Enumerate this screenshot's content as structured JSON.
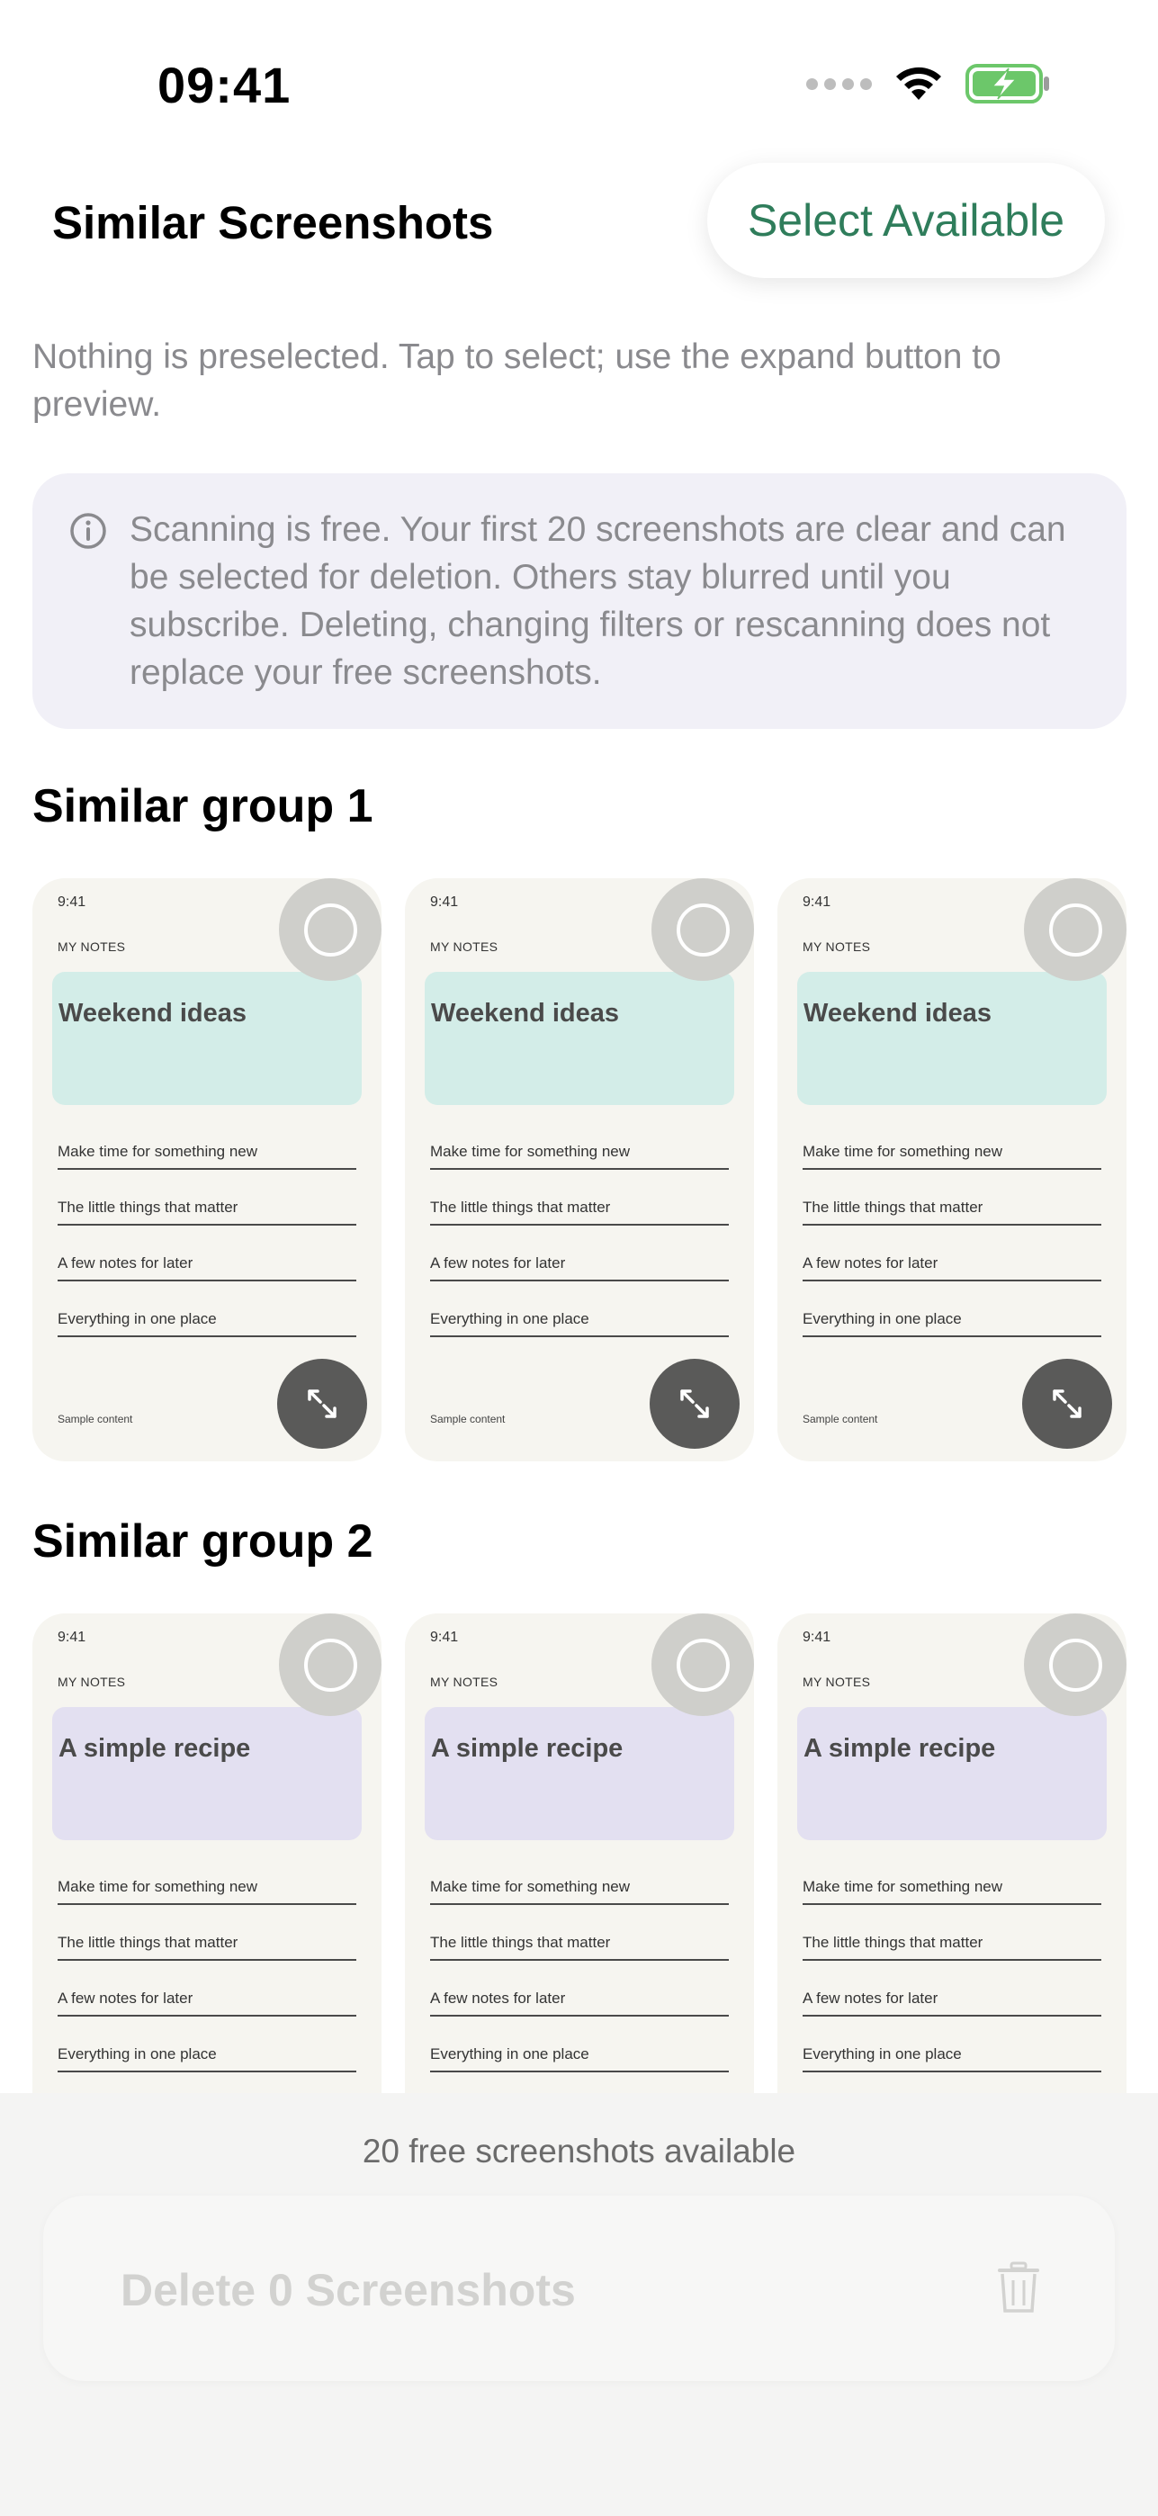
{
  "status_bar": {
    "time": "09:41"
  },
  "header": {
    "title": "Similar Screenshots",
    "select_available_label": "Select Available"
  },
  "hint": "Nothing is preselected. Tap to select; use the expand button to preview.",
  "info_banner": {
    "icon": "info-icon",
    "text": "Scanning is free. Your first 20 screenshots are clear and can be selected for deletion. Others stay blurred until you subscribe. Deleting, changing filters or rescanning does not replace your free screenshots."
  },
  "groups": [
    {
      "title": "Similar group 1",
      "accent_color": "#d3ede8",
      "thumbnails": [
        {
          "time": "9:41",
          "label": "MY NOTES",
          "heading": "Weekend ideas",
          "lines": [
            "Make time for something new",
            "The little things that matter",
            "A few notes for later",
            "Everything in one place"
          ],
          "footer": "Sample content"
        },
        {
          "time": "9:41",
          "label": "MY NOTES",
          "heading": "Weekend ideas",
          "lines": [
            "Make time for something new",
            "The little things that matter",
            "A few notes for later",
            "Everything in one place"
          ],
          "footer": "Sample content"
        },
        {
          "time": "9:41",
          "label": "MY NOTES",
          "heading": "Weekend ideas",
          "lines": [
            "Make time for something new",
            "The little things that matter",
            "A few notes for later",
            "Everything in one place"
          ],
          "footer": "Sample content"
        }
      ]
    },
    {
      "title": "Similar group 2",
      "accent_color": "#e3e0f1",
      "thumbnails": [
        {
          "time": "9:41",
          "label": "MY NOTES",
          "heading": "A simple recipe",
          "lines": [
            "Make time for something new",
            "The little things that matter",
            "A few notes for later",
            "Everything in one place"
          ]
        },
        {
          "time": "9:41",
          "label": "MY NOTES",
          "heading": "A simple recipe",
          "lines": [
            "Make time for something new",
            "The little things that matter",
            "A few notes for later",
            "Everything in one place"
          ]
        },
        {
          "time": "9:41",
          "label": "MY NOTES",
          "heading": "A simple recipe",
          "lines": [
            "Make time for something new",
            "The little things that matter",
            "A few notes for later",
            "Everything in one place"
          ]
        }
      ]
    }
  ],
  "bottom_bar": {
    "free_count_text": "20 free screenshots available",
    "delete_label": "Delete 0 Screenshots",
    "delete_icon": "trash-icon"
  },
  "colors": {
    "accent_green": "#2f7d5b",
    "battery_green": "#6cc76a"
  }
}
